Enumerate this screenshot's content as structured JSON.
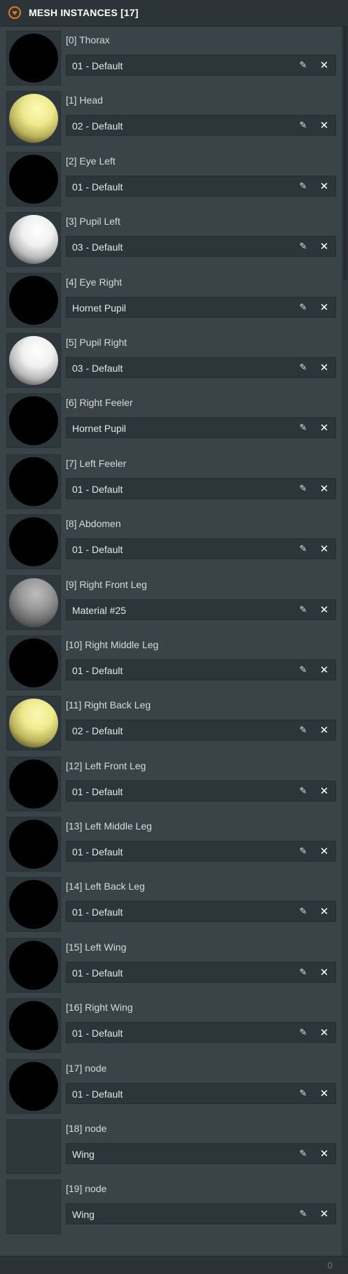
{
  "panel": {
    "title": "MESH INSTANCES [17]",
    "collapse_icon": "chevron-down-icon",
    "accent_color": "#e07a1f"
  },
  "instances": [
    {
      "label": "[0] Thorax",
      "material": "01 - Default",
      "swatch": "black"
    },
    {
      "label": "[1] Head",
      "material": "02 - Default",
      "swatch": "yellow"
    },
    {
      "label": "[2] Eye Left",
      "material": "01 - Default",
      "swatch": "black"
    },
    {
      "label": "[3] Pupil Left",
      "material": "03 - Default",
      "swatch": "white"
    },
    {
      "label": "[4] Eye Right",
      "material": "Hornet Pupil",
      "swatch": "black"
    },
    {
      "label": "[5] Pupil Right",
      "material": "03 - Default",
      "swatch": "white"
    },
    {
      "label": "[6] Right Feeler",
      "material": "Hornet Pupil",
      "swatch": "black"
    },
    {
      "label": "[7] Left Feeler",
      "material": "01 - Default",
      "swatch": "black"
    },
    {
      "label": "[8] Abdomen",
      "material": "01 - Default",
      "swatch": "black"
    },
    {
      "label": "[9] Right Front Leg",
      "material": "Material #25",
      "swatch": "gray"
    },
    {
      "label": "[10] Right Middle Leg",
      "material": "01 - Default",
      "swatch": "black"
    },
    {
      "label": "[11] Right Back Leg",
      "material": "02 - Default",
      "swatch": "yellow"
    },
    {
      "label": "[12] Left Front Leg",
      "material": "01 - Default",
      "swatch": "black"
    },
    {
      "label": "[13] Left Middle Leg",
      "material": "01 - Default",
      "swatch": "black"
    },
    {
      "label": "[14] Left Back Leg",
      "material": "01 - Default",
      "swatch": "black"
    },
    {
      "label": "[15] Left Wing",
      "material": "01 - Default",
      "swatch": "black"
    },
    {
      "label": "[16] Right Wing",
      "material": "01 - Default",
      "swatch": "black"
    },
    {
      "label": "[17] node",
      "material": "01 - Default",
      "swatch": "black"
    },
    {
      "label": "[18] node",
      "material": "Wing",
      "swatch": "none"
    },
    {
      "label": "[19] node",
      "material": "Wing",
      "swatch": "none"
    }
  ],
  "icons": {
    "edit": "pencil-icon",
    "remove": "close-icon"
  },
  "footer": {
    "count": "0"
  }
}
